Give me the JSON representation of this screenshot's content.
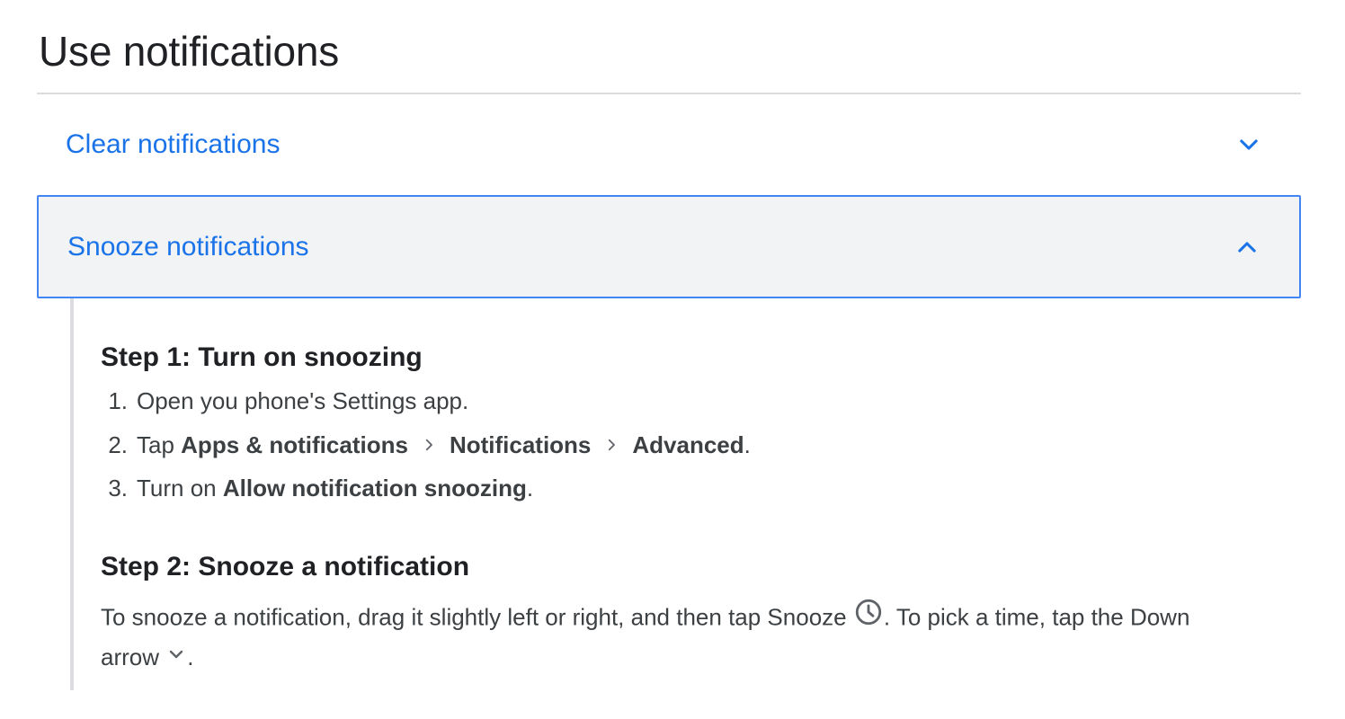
{
  "page": {
    "title": "Use notifications"
  },
  "accordion": {
    "clear": {
      "label": "Clear notifications",
      "icon": "chevron-down-icon",
      "expanded": false
    },
    "snooze": {
      "label": "Snooze notifications",
      "icon": "chevron-up-icon",
      "expanded": true
    }
  },
  "content": {
    "step1": {
      "heading": "Step 1: Turn on snoozing",
      "items": [
        {
          "num": "1.",
          "text": "Open you phone's Settings app."
        },
        {
          "num": "2.",
          "prefix": "Tap ",
          "path": [
            "Apps & notifications",
            "Notifications",
            "Advanced"
          ],
          "suffix": "."
        },
        {
          "num": "3.",
          "prefix": "Turn on ",
          "bold": "Allow notification snoozing",
          "suffix": "."
        }
      ]
    },
    "step2": {
      "heading": "Step 2: Snooze a notification",
      "text_part1": "To snooze a notification, drag it slightly left or right, and then tap Snooze ",
      "text_part2": ". To pick a time, tap the Down arrow ",
      "text_part3": ".",
      "snooze_icon": "clock-icon",
      "arrow_icon": "chevron-down-icon"
    }
  },
  "colors": {
    "link": "#1a73e8",
    "active_border": "#4285f4",
    "active_bg": "#f1f3f4",
    "text": "#202124",
    "body_text": "#3c4043",
    "divider": "#dadce0"
  }
}
